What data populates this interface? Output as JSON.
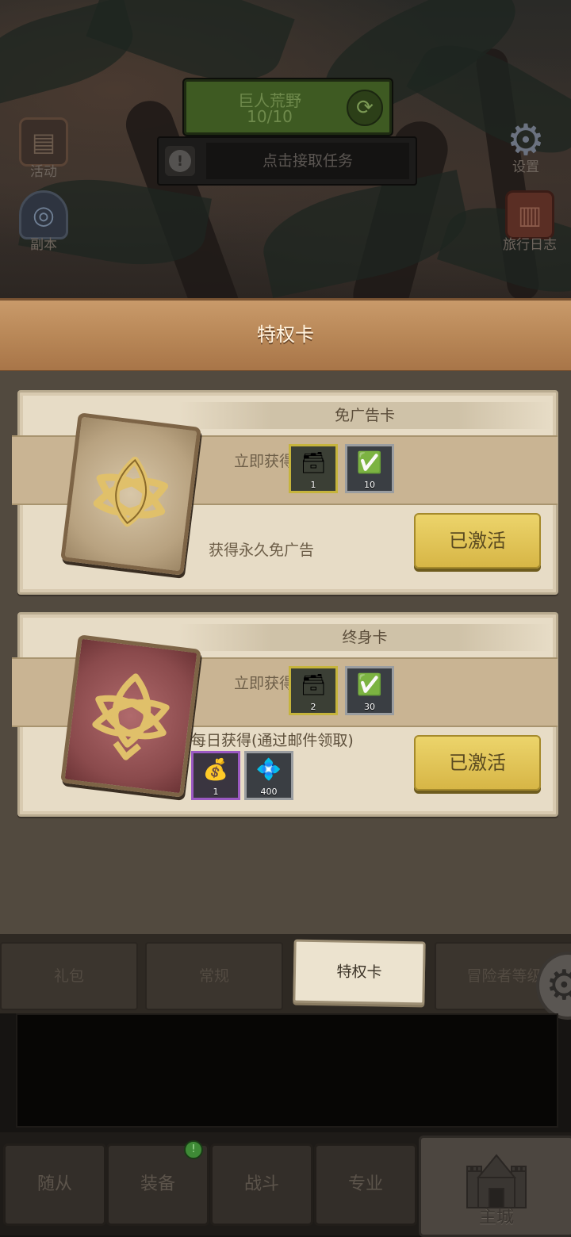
{
  "hud": {
    "zone_name": "巨人荒野",
    "zone_progress": "10/10",
    "quest_text": "点击接取任务",
    "left_buttons": [
      {
        "label": "活动",
        "icon": "scroll-icon"
      },
      {
        "label": "副本",
        "icon": "portal-icon"
      }
    ],
    "right_buttons": [
      {
        "label": "设置",
        "icon": "gear-icon"
      },
      {
        "label": "旅行日志",
        "icon": "book-icon"
      }
    ]
  },
  "panel": {
    "title": "特权卡"
  },
  "cards": [
    {
      "name": "免广告卡",
      "instant_label": "立即获得",
      "instant_items": [
        {
          "icon": "chest-check-icon",
          "qty": "1",
          "rarity": "gold"
        },
        {
          "icon": "ticket-check-icon",
          "qty": "10",
          "rarity": "gray"
        }
      ],
      "perk_text": "获得永久免广告",
      "button_label": "已激活"
    },
    {
      "name": "终身卡",
      "instant_label": "立即获得",
      "instant_items": [
        {
          "icon": "chest-check-icon",
          "qty": "2",
          "rarity": "gold"
        },
        {
          "icon": "ticket-check-icon",
          "qty": "30",
          "rarity": "gray"
        }
      ],
      "daily_label": "每日获得(通过邮件领取)",
      "daily_items": [
        {
          "icon": "gold-pile-icon",
          "qty": "1",
          "rarity": "purple"
        },
        {
          "icon": "gem-icon",
          "qty": "400",
          "rarity": "gray"
        }
      ],
      "button_label": "已激活"
    }
  ],
  "tabs": [
    {
      "label": "礼包",
      "active": false
    },
    {
      "label": "常规",
      "active": false
    },
    {
      "label": "特权卡",
      "active": true
    },
    {
      "label": "冒险者等级",
      "active": false
    }
  ],
  "bottom_nav": [
    {
      "label": "随从"
    },
    {
      "label": "装备",
      "badge": "!"
    },
    {
      "label": "战斗"
    },
    {
      "label": "专业"
    },
    {
      "label": "主城",
      "icon": "castle-icon"
    }
  ],
  "colors": {
    "accent_gold": "#d7b646",
    "title_wood": "#b78656",
    "zone_green": "#3e5a22"
  }
}
